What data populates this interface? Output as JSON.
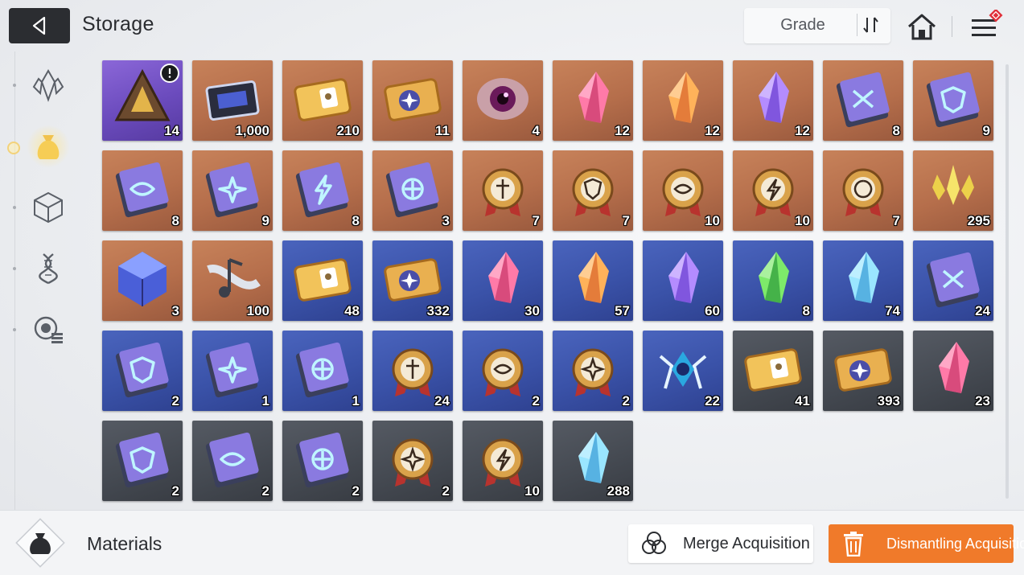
{
  "header": {
    "title": "Storage",
    "sort_label": "Grade"
  },
  "sidebar": {
    "tabs": [
      {
        "name": "gem-icon",
        "active": false
      },
      {
        "name": "material-bag-icon",
        "active": true
      },
      {
        "name": "cube-icon",
        "active": false
      },
      {
        "name": "dna-icon",
        "active": false
      },
      {
        "name": "list-icon",
        "active": false
      }
    ]
  },
  "items": [
    {
      "kind": "triangle-box",
      "rarity": "purple",
      "qty": "14",
      "badge": "timer"
    },
    {
      "kind": "chip",
      "rarity": "orange",
      "qty": "1,000"
    },
    {
      "kind": "card",
      "rarity": "orange",
      "qty": "210"
    },
    {
      "kind": "ticket-star",
      "rarity": "orange",
      "qty": "11"
    },
    {
      "kind": "eye-orb",
      "rarity": "orange",
      "qty": "4"
    },
    {
      "kind": "crystal-pink",
      "rarity": "orange",
      "qty": "12"
    },
    {
      "kind": "crystal-orange",
      "rarity": "orange",
      "qty": "12"
    },
    {
      "kind": "crystal-purple",
      "rarity": "orange",
      "qty": "12"
    },
    {
      "kind": "book-cross",
      "rarity": "orange",
      "qty": "8"
    },
    {
      "kind": "book-shield",
      "rarity": "orange",
      "qty": "9"
    },
    {
      "kind": "book-eye",
      "rarity": "orange",
      "qty": "8"
    },
    {
      "kind": "book-star",
      "rarity": "orange",
      "qty": "9"
    },
    {
      "kind": "book-bolt",
      "rarity": "orange",
      "qty": "8"
    },
    {
      "kind": "book-rune",
      "rarity": "orange",
      "qty": "3"
    },
    {
      "kind": "medal-sword",
      "rarity": "orange",
      "qty": "7"
    },
    {
      "kind": "medal-shield",
      "rarity": "orange",
      "qty": "7"
    },
    {
      "kind": "medal-eye",
      "rarity": "orange",
      "qty": "10"
    },
    {
      "kind": "medal-bolt",
      "rarity": "orange",
      "qty": "10"
    },
    {
      "kind": "medal-rune",
      "rarity": "orange",
      "qty": "7"
    },
    {
      "kind": "shards-gold",
      "rarity": "orange",
      "qty": "295"
    },
    {
      "kind": "cube-blue",
      "rarity": "orange",
      "qty": "3"
    },
    {
      "kind": "music-note",
      "rarity": "orange",
      "qty": "100"
    },
    {
      "kind": "card",
      "rarity": "blue",
      "qty": "48"
    },
    {
      "kind": "ticket-star",
      "rarity": "blue",
      "qty": "332"
    },
    {
      "kind": "crystal-pink",
      "rarity": "blue",
      "qty": "30"
    },
    {
      "kind": "crystal-orange",
      "rarity": "blue",
      "qty": "57"
    },
    {
      "kind": "crystal-purple",
      "rarity": "blue",
      "qty": "60"
    },
    {
      "kind": "crystal-green",
      "rarity": "blue",
      "qty": "8"
    },
    {
      "kind": "crystal-cyan",
      "rarity": "blue",
      "qty": "74"
    },
    {
      "kind": "book-cross",
      "rarity": "blue",
      "qty": "24"
    },
    {
      "kind": "book-shield",
      "rarity": "blue",
      "qty": "2"
    },
    {
      "kind": "book-star",
      "rarity": "blue",
      "qty": "1"
    },
    {
      "kind": "book-rune",
      "rarity": "blue",
      "qty": "1"
    },
    {
      "kind": "medal-sword",
      "rarity": "blue",
      "qty": "24"
    },
    {
      "kind": "medal-eye",
      "rarity": "blue",
      "qty": "2"
    },
    {
      "kind": "medal-star",
      "rarity": "blue",
      "qty": "2"
    },
    {
      "kind": "orb-ice",
      "rarity": "blue",
      "qty": "22"
    },
    {
      "kind": "card",
      "rarity": "gray",
      "qty": "41"
    },
    {
      "kind": "ticket-star",
      "rarity": "gray",
      "qty": "393"
    },
    {
      "kind": "crystal-pink",
      "rarity": "gray",
      "qty": "23"
    },
    {
      "kind": "book-shield",
      "rarity": "gray",
      "qty": "2"
    },
    {
      "kind": "book-eye",
      "rarity": "gray",
      "qty": "2"
    },
    {
      "kind": "book-rune",
      "rarity": "gray",
      "qty": "2"
    },
    {
      "kind": "medal-star",
      "rarity": "gray",
      "qty": "2"
    },
    {
      "kind": "medal-bolt",
      "rarity": "gray",
      "qty": "10"
    },
    {
      "kind": "crystal-cyan",
      "rarity": "gray",
      "qty": "288"
    }
  ],
  "footer": {
    "category_label": "Materials",
    "merge_label": "Merge Acquisition",
    "dismantle_label": "Dismantling Acquisition"
  },
  "colors": {
    "accent_orange": "#f07a2a",
    "dark_button": "#2b2d31",
    "notification_red": "#e0303a"
  }
}
